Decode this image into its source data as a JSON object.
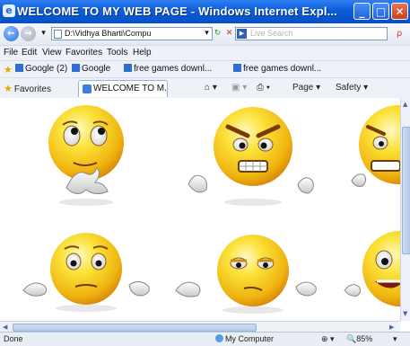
{
  "window": {
    "title": "WELCOME TO MY WEB PAGE - Windows Internet Expl...",
    "app_icon": "ie-logo-icon",
    "controls": {
      "minimize": "_",
      "maximize": "□",
      "close": "✕"
    }
  },
  "address_bar": {
    "back": "←",
    "forward": "→",
    "url": "D:\\Vidhya Bharti\\Compu",
    "refresh": "↻",
    "stop": "✕",
    "search_placeholder": "Live Search",
    "search_button": "ρ"
  },
  "menu": [
    "File",
    "Edit",
    "View",
    "Favorites",
    "Tools",
    "Help"
  ],
  "links_bar": [
    "Google (2)",
    "Google",
    "free games downl...",
    "free games downl..."
  ],
  "tab_bar": {
    "favorites": "Favorites",
    "active_tab": "WELCOME TO M...",
    "commands": [
      "Page ▾",
      "Safety ▾"
    ],
    "icons": [
      "home-icon",
      "feeds-icon",
      "print-icon"
    ]
  },
  "content": {
    "images": [
      {
        "name": "smiley-thinking",
        "description": "emoticon"
      },
      {
        "name": "smiley-angry",
        "description": "emoticon"
      },
      {
        "name": "smiley-partial-right-top",
        "description": "emoticon"
      },
      {
        "name": "smiley-shrug",
        "description": "emoticon"
      },
      {
        "name": "smiley-shrug-squint",
        "description": "emoticon"
      },
      {
        "name": "smiley-partial-right-bottom",
        "description": "emoticon"
      }
    ]
  },
  "status_bar": {
    "left": "Done",
    "zone": "My Computer",
    "zoom": "85%"
  },
  "colors": {
    "title_blue": "#0b5ed8",
    "face_yellow": "#f7c81e",
    "face_orange": "#e79a12"
  }
}
